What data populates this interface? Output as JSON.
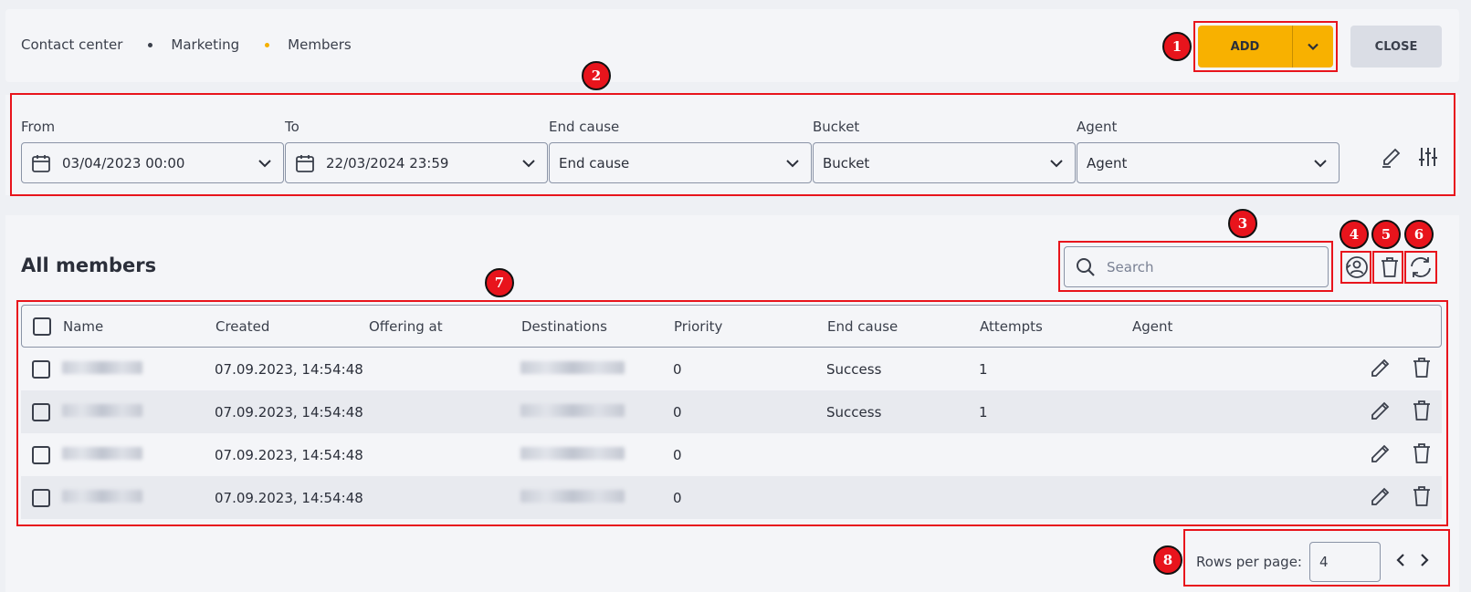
{
  "breadcrumb": [
    "Contact center",
    "Marketing",
    "Members"
  ],
  "header": {
    "add_label": "ADD",
    "close_label": "CLOSE"
  },
  "filters": {
    "from": {
      "label": "From",
      "value": "03/04/2023 00:00"
    },
    "to": {
      "label": "To",
      "value": "22/03/2024 23:59"
    },
    "end_cause": {
      "label": "End cause",
      "value": "End cause"
    },
    "bucket": {
      "label": "Bucket",
      "value": "Bucket"
    },
    "agent": {
      "label": "Agent",
      "value": "Agent"
    }
  },
  "main": {
    "title": "All members",
    "search_placeholder": "Search"
  },
  "table": {
    "columns": [
      "Name",
      "Created",
      "Offering at",
      "Destinations",
      "Priority",
      "End cause",
      "Attempts",
      "Agent"
    ],
    "rows": [
      {
        "created": "07.09.2023, 14:54:48",
        "priority": "0",
        "end_cause": "Success",
        "attempts": "1"
      },
      {
        "created": "07.09.2023, 14:54:48",
        "priority": "0",
        "end_cause": "Success",
        "attempts": "1"
      },
      {
        "created": "07.09.2023, 14:54:48",
        "priority": "0",
        "end_cause": "",
        "attempts": ""
      },
      {
        "created": "07.09.2023, 14:54:48",
        "priority": "0",
        "end_cause": "",
        "attempts": ""
      }
    ]
  },
  "pagination": {
    "label": "Rows per page:",
    "value": "4"
  },
  "annotations": [
    "1",
    "2",
    "3",
    "4",
    "5",
    "6",
    "7",
    "8"
  ],
  "colors": {
    "accent": "#f8b100",
    "annotation": "#e8141c"
  }
}
